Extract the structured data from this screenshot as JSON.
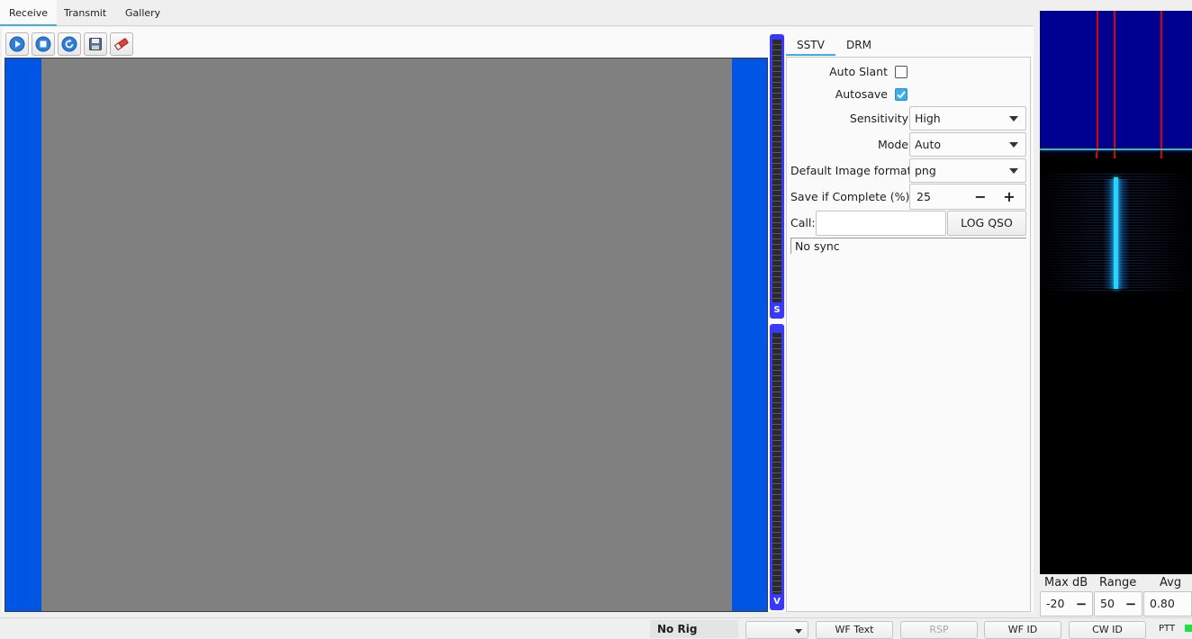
{
  "main_tabs": [
    {
      "label": "Receive",
      "active": true
    },
    {
      "label": "Transmit",
      "active": false
    },
    {
      "label": "Gallery",
      "active": false
    }
  ],
  "toolbar": {
    "icons": [
      "play-icon",
      "stop-icon",
      "refresh-icon",
      "save-icon",
      "eraser-icon"
    ]
  },
  "image_area": {
    "border_color": "#0055e5",
    "fill_color": "#808080"
  },
  "meters": {
    "sync_label": "S",
    "volume_label": "V"
  },
  "sub_tabs": [
    {
      "label": "SSTV",
      "active": true
    },
    {
      "label": "DRM",
      "active": false
    }
  ],
  "settings": {
    "auto_slant_label": "Auto Slant",
    "auto_slant_checked": false,
    "autosave_label": "Autosave",
    "autosave_checked": true,
    "sensitivity_label": "Sensitivity",
    "sensitivity_value": "High",
    "mode_label": "Mode",
    "mode_value": "Auto",
    "format_label": "Default Image format",
    "format_value": "png",
    "save_complete_label": "Save if Complete (%)",
    "save_complete_value": "25",
    "call_label": "Call:",
    "call_value": "",
    "log_qso_label": "LOG QSO",
    "status_text": "No sync"
  },
  "spectrum_controls": {
    "max_db_label": "Max dB",
    "max_db_value": "-20",
    "range_label": "Range",
    "range_value": "50",
    "avg_label": "Avg",
    "avg_value": "0.80"
  },
  "bottom_bar": {
    "rig_status": "No Rig",
    "wf_text_label": "WF Text",
    "rsp_label": "RSP",
    "wf_id_label": "WF ID",
    "cw_id_label": "CW ID",
    "ptt_label": "PTT"
  },
  "colors": {
    "accent": "#3daee9",
    "spectrum_bg": "#000090",
    "marker": "#e00000",
    "waterfall_signal": "#25d5ff"
  }
}
